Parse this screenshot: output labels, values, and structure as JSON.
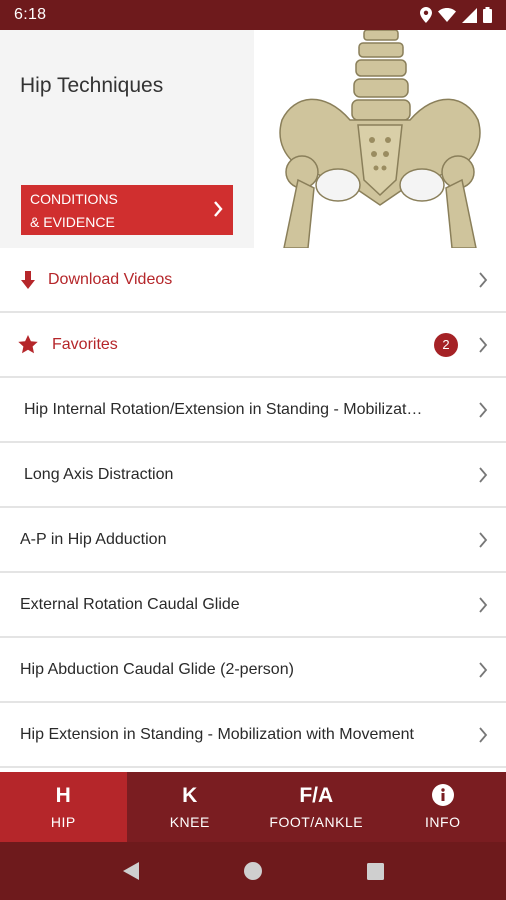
{
  "status_bar": {
    "time": "6:18"
  },
  "hero": {
    "title": "Hip Techniques",
    "conditions_button": {
      "line1": "CONDITIONS",
      "line2": "& EVIDENCE"
    }
  },
  "download": {
    "label": "Download Videos"
  },
  "favorites": {
    "label": "Favorites",
    "count": "2"
  },
  "techniques": [
    {
      "label": "Hip Internal Rotation/Extension in Standing - Mobilizat…"
    },
    {
      "label": "Long Axis Distraction"
    },
    {
      "label": "A-P in Hip Adduction"
    },
    {
      "label": "External Rotation Caudal Glide"
    },
    {
      "label": "Hip Abduction Caudal Glide (2-person)"
    },
    {
      "label": "Hip Extension in Standing - Mobilization with Movement"
    }
  ],
  "tabs": [
    {
      "glyph": "H",
      "label": "HIP",
      "active": true
    },
    {
      "glyph": "K",
      "label": "KNEE",
      "active": false
    },
    {
      "glyph": "F/A",
      "label": "FOOT/ANKLE",
      "active": false
    },
    {
      "glyph": "info-icon",
      "label": "INFO",
      "active": false
    }
  ],
  "colors": {
    "brand_dark": "#6e1a1c",
    "tab_bar": "#7a1d21",
    "accent_red": "#b5262a",
    "button_red": "#d02f2f",
    "badge": "#a52226"
  }
}
